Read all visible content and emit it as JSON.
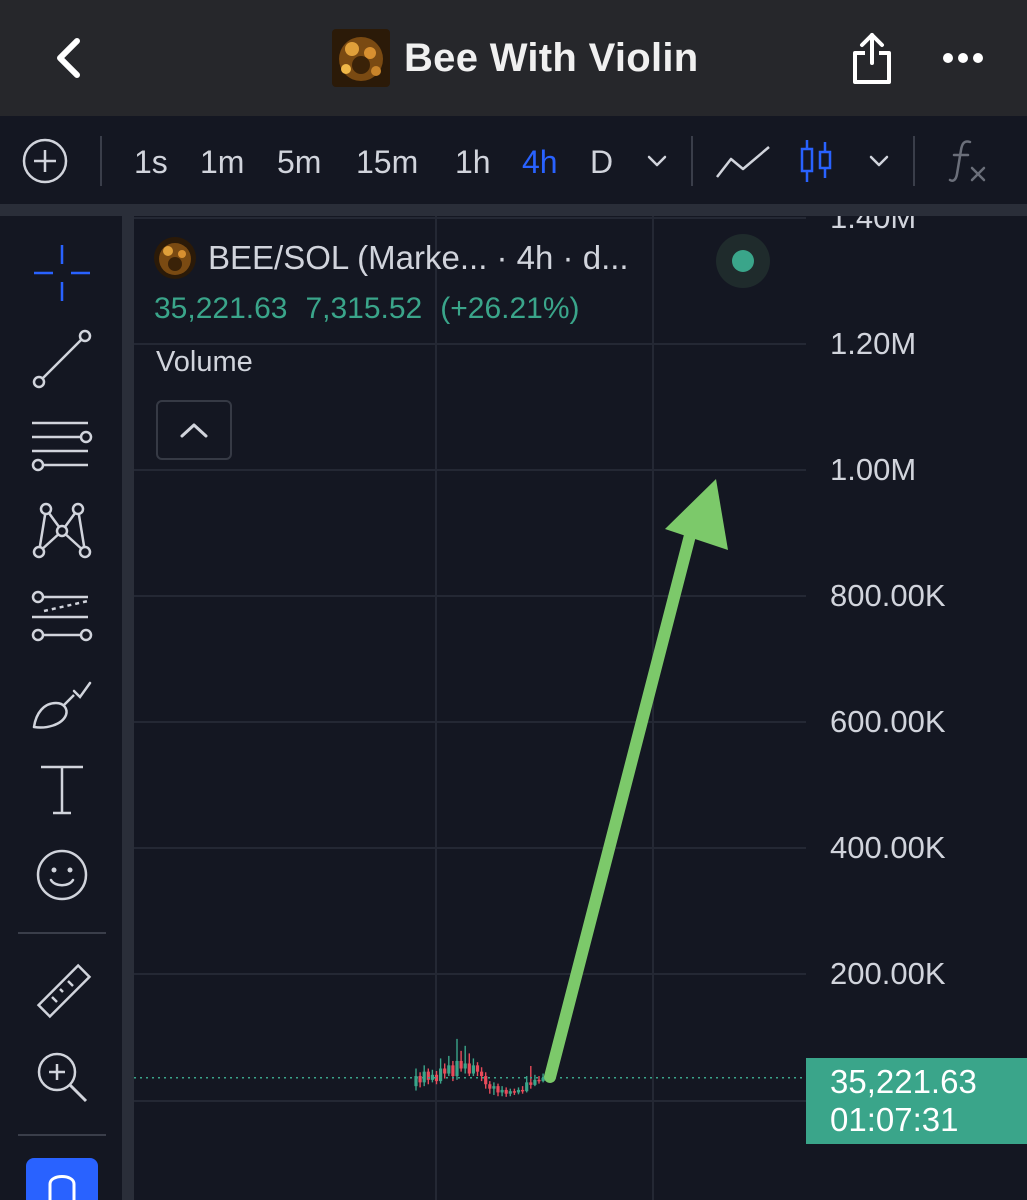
{
  "header": {
    "title": "Bee With Violin"
  },
  "toolbar": {
    "intervals": [
      "1s",
      "1m",
      "5m",
      "15m",
      "1h",
      "4h",
      "D"
    ],
    "active_interval": "4h"
  },
  "chart": {
    "symbol_line": "BEE/SOL (Marke... · 4h · d...",
    "last_price": "35,221.63",
    "change": "7,315.52",
    "change_pct": "(+26.21%)",
    "indicator_label": "Volume",
    "price_label": {
      "price": "35,221.63",
      "countdown": "01:07:31"
    },
    "up_color": "#3aa58a",
    "down_color": "#e84b5a",
    "arrow_color": "#7cc96a"
  },
  "chart_data": {
    "type": "line",
    "y_tick_labels": [
      "1.40M",
      "1.20M",
      "1.00M",
      "800.00K",
      "600.00K",
      "400.00K",
      "200.00K"
    ],
    "y_tick_values": [
      1400000,
      1200000,
      1000000,
      800000,
      600000,
      400000,
      200000
    ],
    "ylim": [
      0,
      1450000
    ],
    "last_value": 35221.63,
    "candles": [
      {
        "o": 22000,
        "c": 38000,
        "h": 50000,
        "l": 15000
      },
      {
        "o": 38000,
        "c": 28000,
        "h": 44000,
        "l": 20000
      },
      {
        "o": 28000,
        "c": 45000,
        "h": 55000,
        "l": 22000
      },
      {
        "o": 45000,
        "c": 32000,
        "h": 50000,
        "l": 25000
      },
      {
        "o": 32000,
        "c": 40000,
        "h": 48000,
        "l": 28000
      },
      {
        "o": 40000,
        "c": 30000,
        "h": 46000,
        "l": 25000
      },
      {
        "o": 30000,
        "c": 50000,
        "h": 66000,
        "l": 26000
      },
      {
        "o": 50000,
        "c": 42000,
        "h": 58000,
        "l": 34000
      },
      {
        "o": 42000,
        "c": 55000,
        "h": 70000,
        "l": 38000
      },
      {
        "o": 55000,
        "c": 38000,
        "h": 62000,
        "l": 30000
      },
      {
        "o": 38000,
        "c": 62000,
        "h": 97000,
        "l": 32000
      },
      {
        "o": 62000,
        "c": 50000,
        "h": 78000,
        "l": 45000
      },
      {
        "o": 50000,
        "c": 58000,
        "h": 86000,
        "l": 42000
      },
      {
        "o": 58000,
        "c": 42000,
        "h": 74000,
        "l": 38000
      },
      {
        "o": 42000,
        "c": 55000,
        "h": 66000,
        "l": 38000
      },
      {
        "o": 55000,
        "c": 45000,
        "h": 60000,
        "l": 38000
      },
      {
        "o": 45000,
        "c": 38000,
        "h": 52000,
        "l": 30000
      },
      {
        "o": 38000,
        "c": 25000,
        "h": 44000,
        "l": 18000
      },
      {
        "o": 25000,
        "c": 18000,
        "h": 30000,
        "l": 10000
      },
      {
        "o": 18000,
        "c": 22000,
        "h": 28000,
        "l": 8000
      },
      {
        "o": 22000,
        "c": 12000,
        "h": 26000,
        "l": 6000
      },
      {
        "o": 12000,
        "c": 16000,
        "h": 22000,
        "l": 6000
      },
      {
        "o": 16000,
        "c": 10000,
        "h": 20000,
        "l": 5000
      },
      {
        "o": 10000,
        "c": 14000,
        "h": 18000,
        "l": 6000
      },
      {
        "o": 14000,
        "c": 12000,
        "h": 18000,
        "l": 8000
      },
      {
        "o": 12000,
        "c": 16000,
        "h": 20000,
        "l": 9000
      },
      {
        "o": 16000,
        "c": 14000,
        "h": 22000,
        "l": 10000
      },
      {
        "o": 14000,
        "c": 28000,
        "h": 38000,
        "l": 12000
      },
      {
        "o": 28000,
        "c": 24000,
        "h": 54000,
        "l": 18000
      },
      {
        "o": 24000,
        "c": 32000,
        "h": 40000,
        "l": 22000
      },
      {
        "o": 32000,
        "c": 30000,
        "h": 38000,
        "l": 26000
      },
      {
        "o": 30000,
        "c": 35221.63,
        "h": 42000,
        "l": 28000
      }
    ]
  }
}
